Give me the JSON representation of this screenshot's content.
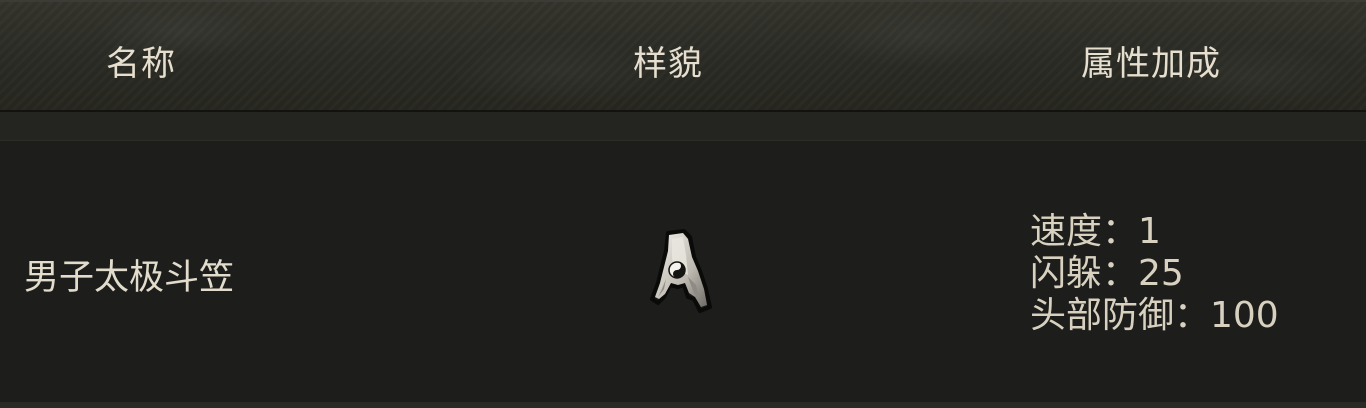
{
  "header": {
    "name_label": "名称",
    "look_label": "样貌",
    "attr_label": "属性加成"
  },
  "item": {
    "name": "男子太极斗笠",
    "icon": "taiji-hat-icon",
    "attributes": [
      "速度：1",
      "闪躲：25",
      "头部防御：100"
    ]
  }
}
